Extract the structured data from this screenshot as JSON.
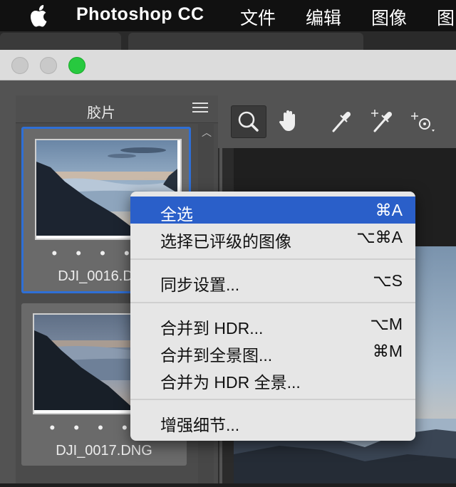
{
  "menubar": {
    "app_name": "Photoshop CC",
    "items": [
      "文件",
      "编辑",
      "图像",
      "图"
    ]
  },
  "filmstrip": {
    "title": "胶片",
    "thumbnails": [
      {
        "filename": "DJI_0016.DNG",
        "rating_dots": "• • • • •"
      },
      {
        "filename": "DJI_0017.DNG",
        "rating_dots": "• • • • •"
      }
    ]
  },
  "toolbar": {
    "tools": [
      "zoom-icon",
      "hand-icon",
      "white-balance-icon",
      "color-sampler-icon",
      "targeted-adjustment-icon"
    ]
  },
  "context_menu": {
    "items": [
      {
        "label": "全选",
        "shortcut": "⌘A",
        "highlighted": true
      },
      {
        "label": "选择已评级的图像",
        "shortcut": "⌥⌘A"
      },
      {
        "label": "同步设置...",
        "shortcut": "⌥S"
      },
      {
        "label": "合并到 HDR...",
        "shortcut": "⌥M"
      },
      {
        "label": "合并到全景图...",
        "shortcut": "⌘M"
      },
      {
        "label": "合并为 HDR 全景...",
        "shortcut": ""
      },
      {
        "label": "增强细节...",
        "shortcut": ""
      }
    ]
  },
  "colors": {
    "highlight": "#2a5fc9",
    "traffic_light_green": "#27c93f",
    "selection_border": "#2e6fd6"
  }
}
